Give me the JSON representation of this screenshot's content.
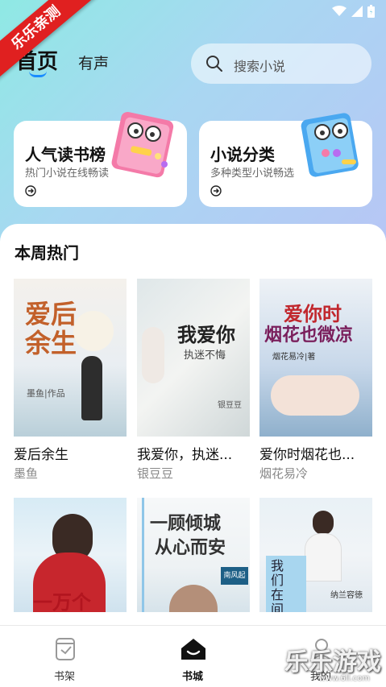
{
  "status": {
    "ribbon": "乐乐亲测"
  },
  "header": {
    "tab_home": "首页",
    "tab_audio": "有声",
    "search_placeholder": "搜索小说"
  },
  "cards": [
    {
      "title": "人气读书榜",
      "subtitle": "热门小说在线畅读"
    },
    {
      "title": "小说分类",
      "subtitle": "多种类型小说畅选"
    }
  ],
  "section": {
    "title": "本周热门"
  },
  "books": [
    {
      "title": "爱后余生",
      "author": "墨鱼",
      "cover_text": "爱后余生",
      "cover_sub": "墨鱼|作品"
    },
    {
      "title": "我爱你，执迷...",
      "author": "银豆豆",
      "cover_text": "我爱你",
      "cover_sub": "执迷不悔",
      "cover_author": "银豆豆"
    },
    {
      "title": "爱你时烟花也...",
      "author": "烟花易冷",
      "cover_text": "爱你时",
      "cover_text2": "烟花也微凉",
      "cover_sub": "烟花易冷|著"
    },
    {
      "cover_text": "一万个"
    },
    {
      "cover_text": "一顾倾城",
      "cover_text2": "从心而安",
      "cover_author": "南风起"
    },
    {
      "cover_text": "我们在间",
      "cover_sub": "纳兰容徳"
    }
  ],
  "nav": [
    {
      "label": "书架"
    },
    {
      "label": "书城"
    },
    {
      "label": "我的"
    }
  ],
  "watermark": {
    "text": "乐乐游戏",
    "url": "www.6ll.com"
  },
  "colors": {
    "accent": "#1a8cff",
    "ribbon": "#e02020"
  }
}
